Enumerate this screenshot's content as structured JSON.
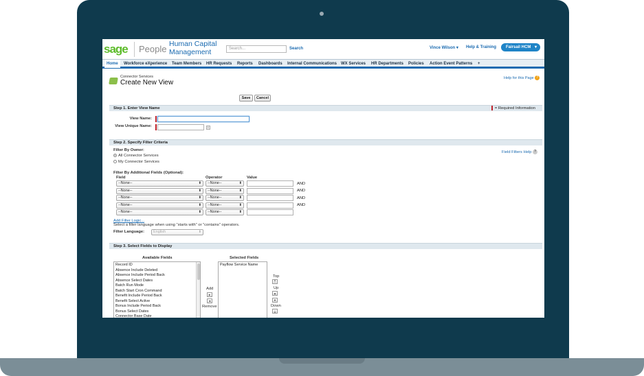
{
  "header": {
    "logo_sage": "sage",
    "logo_people": "People",
    "app_title_line1": "Human Capital",
    "app_title_line2": "Management",
    "search_placeholder": "Search...",
    "search_button": "Search",
    "user_name": "Vince Wilson ▾",
    "help_training": "Help & Training",
    "app_switcher": "Fairsail HCM",
    "app_switcher_caret": "▾"
  },
  "nav": {
    "tabs": [
      {
        "label": "Home"
      },
      {
        "label": "Workforce eXperience"
      },
      {
        "label": "Team Members"
      },
      {
        "label": "HR Requests"
      },
      {
        "label": "Reports"
      },
      {
        "label": "Dashboards"
      },
      {
        "label": "Internal Communications"
      },
      {
        "label": "WX Services"
      },
      {
        "label": "HR Departments"
      },
      {
        "label": "Policies"
      },
      {
        "label": "Action Event Patterns"
      },
      {
        "label": "+"
      }
    ]
  },
  "page": {
    "subtitle": "Connector Services",
    "title": "Create New View",
    "help_link": "Help for this Page",
    "help_icon": "?",
    "save_label": "Save",
    "cancel_label": "Cancel"
  },
  "step1": {
    "heading": "Step 1. Enter View Name",
    "required_legend": "= Required Information",
    "view_name_label": "View Name:",
    "view_name_value": "",
    "view_unique_name_label": "View Unique Name:",
    "view_unique_name_value": "",
    "info_icon": "i"
  },
  "step2": {
    "heading": "Step 2. Specify Filter Criteria",
    "filter_by_owner": "Filter By Owner:",
    "option_all": "All Connector Services",
    "option_mine": "My Connector Services",
    "field_filters_help": "Field Filters Help",
    "help_icon": "?",
    "additional_fields_label": "Filter By Additional Fields (Optional):",
    "col_field": "Field",
    "col_operator": "Operator",
    "col_value": "Value",
    "rows": [
      {
        "field": "--None--",
        "operator": "--None--",
        "value": "",
        "conj": "AND"
      },
      {
        "field": "--None--",
        "operator": "--None--",
        "value": "",
        "conj": "AND"
      },
      {
        "field": "--None--",
        "operator": "--None--",
        "value": "",
        "conj": "AND"
      },
      {
        "field": "--None--",
        "operator": "--None--",
        "value": "",
        "conj": "AND"
      },
      {
        "field": "--None--",
        "operator": "--None--",
        "value": "",
        "conj": ""
      }
    ],
    "select_arrow": "⬍",
    "add_filter_logic": "Add Filter Logic...",
    "filter_hint": "Select a filter language when using \"starts with\" or \"contains\" operators.",
    "filter_language_label": "Filter Language:",
    "filter_language_value": "English"
  },
  "step3": {
    "heading": "Step 3. Select Fields to Display",
    "available_label": "Available Fields",
    "selected_label": "Selected Fields",
    "available_fields": [
      "Record ID",
      "Absence Include Deleted",
      "Absence Include Period Back",
      "Absence Select Dates",
      "Batch Run Mode",
      "Batch Start Cron Command",
      "Benefit Include Period Back",
      "Benefit Select Active",
      "Bonus Include Period Back",
      "Bonus Select Dates",
      "Connector Base Date"
    ],
    "selected_fields": [
      "Payflow Service Name"
    ],
    "add_label": "Add",
    "remove_label": "Remove",
    "add_arrow": "▸",
    "remove_arrow": "◂",
    "top_label": "Top",
    "up_label": "Up",
    "down_label": "Down",
    "top_arrow": "⤒",
    "up_arrow": "▴",
    "down_arrow": "▾",
    "bottom_arrow": "⤓"
  }
}
